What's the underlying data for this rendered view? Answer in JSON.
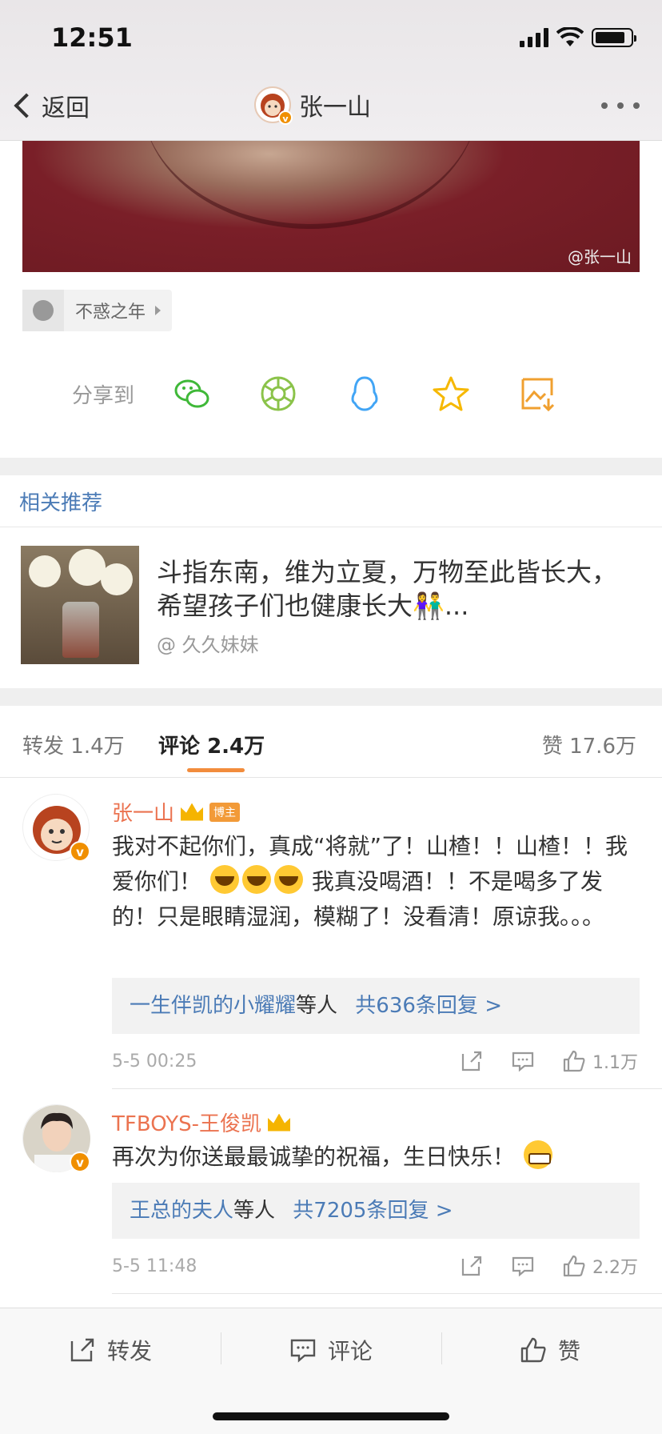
{
  "status": {
    "time": "12:51",
    "battery_level": 0.85
  },
  "nav": {
    "back_label": "返回",
    "title": "张一山"
  },
  "photo": {
    "watermark": "@张一山"
  },
  "topic": {
    "label": "不惑之年"
  },
  "share": {
    "label": "分享到",
    "targets": [
      "wechat-icon",
      "moments-icon",
      "qq-icon",
      "favorite-star-icon",
      "save-image-icon"
    ]
  },
  "related": {
    "heading": "相关推荐",
    "text": "斗指东南，维为立夏，万物至此皆长大，希望孩子们也健康长大👫...",
    "author": "@ 久久妹妹"
  },
  "tabs": {
    "repost_label": "转发",
    "repost_count": "1.4万",
    "comment_label": "评论",
    "comment_count": "2.4万",
    "like_label": "赞",
    "like_count": "17.6万"
  },
  "comments": [
    {
      "name": "张一山",
      "badge": "博主",
      "text_part1": "我对不起你们，真成“将就”了！山楂！！山楂！！我爱你们！",
      "text_part2": "我真没喝酒！！不是喝多了发的！只是眼睛湿润，模糊了！没看清！原谅我。。。",
      "reply_users": "一生伴凯的小耀耀",
      "reply_suffix": "等人",
      "reply_count": "共636条回复 >",
      "time": "5-5 00:25",
      "likes": "1.1万"
    },
    {
      "name": "TFBOYS-王俊凯",
      "text": "再次为你送最最诚挚的祝福，生日快乐！",
      "reply_users": "王总的夫人",
      "reply_suffix": "等人",
      "reply_count": "共7205条回复 >",
      "time": "5-5 11:48",
      "likes": "2.2万"
    }
  ],
  "bottom": {
    "repost": "转发",
    "comment": "评论",
    "like": "赞"
  },
  "colors": {
    "link_blue": "#4b7bb6",
    "name_orange": "#eb7350",
    "tab_accent": "#f28c3c"
  }
}
